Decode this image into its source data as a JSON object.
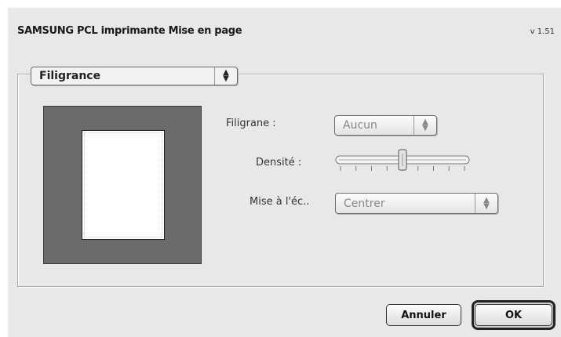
{
  "dialog": {
    "title": "SAMSUNG PCL imprimante Mise en page",
    "version": "v 1.51"
  },
  "panel_selector": {
    "selected": "Filigrance"
  },
  "watermark": {
    "filigrane_label": "Filigrane :",
    "filigrane_value": "Aucun",
    "densite_label": "Densité :",
    "densite_level": 0.5,
    "mise_label": "Mise à l'éc..",
    "mise_value": "Centrer"
  },
  "buttons": {
    "cancel": "Annuler",
    "ok": "OK"
  },
  "icons": {
    "popup_arrows": "up-down-arrows-icon",
    "slider_thumb": "slider-thumb-icon"
  },
  "colors": {
    "dialog_bg": "#e8e8e8",
    "preview_bg": "#6b6b6b",
    "page": "#ffffff",
    "disabled_text": "#888888"
  }
}
